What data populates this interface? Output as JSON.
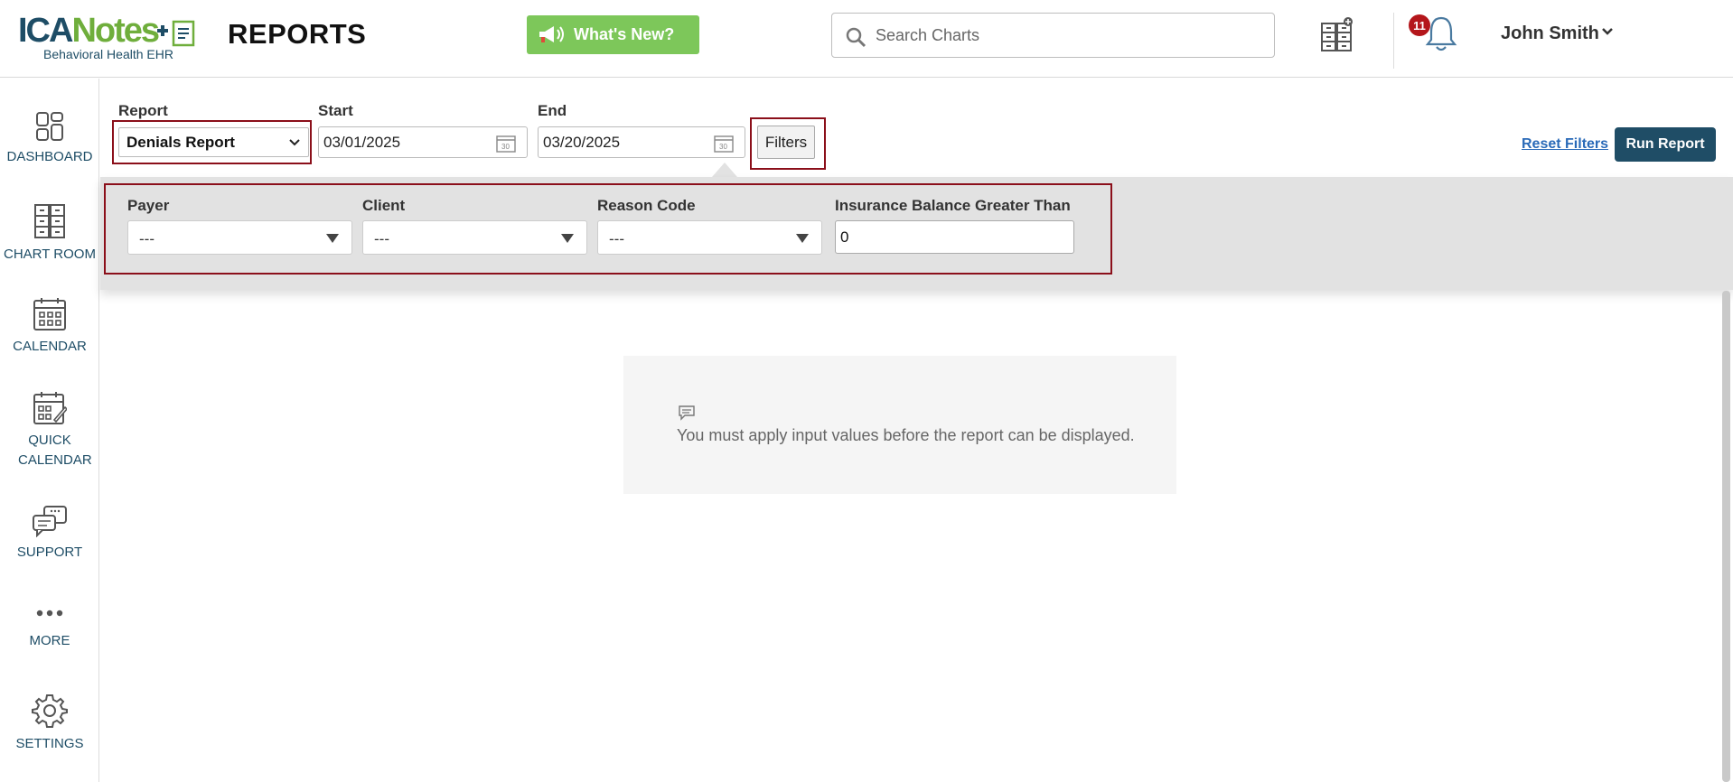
{
  "header": {
    "logo_main_a": "ICA",
    "logo_main_b": "Notes",
    "logo_sub": "Behavioral Health EHR",
    "page_title": "REPORTS",
    "whats_new_label": "What's New?",
    "search_placeholder": "Search Charts",
    "notification_count": "11",
    "user_name": "John Smith"
  },
  "sidebar": {
    "items": [
      {
        "label": "DASHBOARD",
        "icon": "dashboard-icon"
      },
      {
        "label": "CHART ROOM",
        "icon": "chart-room-icon"
      },
      {
        "label": "CALENDAR",
        "icon": "calendar-icon"
      },
      {
        "label": "QUICK CALENDAR",
        "icon": "quick-calendar-icon"
      },
      {
        "label": "SUPPORT",
        "icon": "support-icon"
      },
      {
        "label": "MORE",
        "icon": "more-icon"
      },
      {
        "label": "SETTINGS",
        "icon": "settings-icon"
      }
    ]
  },
  "toolbar": {
    "report_label": "Report",
    "report_value": "Denials Report",
    "start_label": "Start",
    "start_value": "03/01/2025",
    "end_label": "End",
    "end_value": "03/20/2025",
    "filters_label": "Filters",
    "reset_label": "Reset Filters",
    "run_label": "Run Report"
  },
  "filters": {
    "payer_label": "Payer",
    "payer_value": "---",
    "client_label": "Client",
    "client_value": "---",
    "reason_label": "Reason Code",
    "reason_value": "---",
    "balance_label": "Insurance Balance Greater Than",
    "balance_value": "0"
  },
  "message": {
    "text": "You must apply input values before the report can be displayed."
  },
  "colors": {
    "brand_dark": "#1e4d66",
    "brand_green": "#6fae3c",
    "highlight": "#8b0f1a",
    "badge": "#b4161b"
  }
}
